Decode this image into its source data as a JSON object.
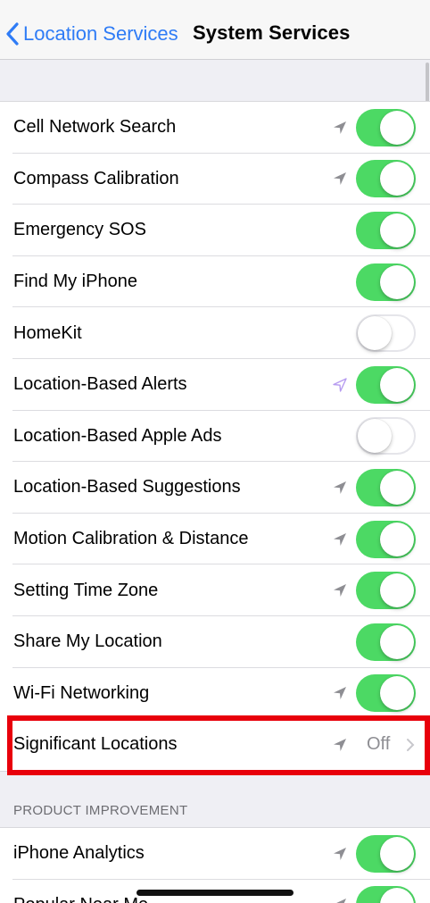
{
  "navbar": {
    "back_label": "Location Services",
    "title": "System Services"
  },
  "colors": {
    "accent": "#2f7cf6",
    "toggle_on": "#4cd964",
    "arrow_gray": "#8e8e93",
    "arrow_purple": "#b69bf0",
    "highlight": "#e8000b"
  },
  "services": [
    {
      "label": "Cell Network Search",
      "arrow": "gray",
      "toggle": "on"
    },
    {
      "label": "Compass Calibration",
      "arrow": "gray",
      "toggle": "on"
    },
    {
      "label": "Emergency SOS",
      "arrow": "none",
      "toggle": "on"
    },
    {
      "label": "Find My iPhone",
      "arrow": "none",
      "toggle": "on"
    },
    {
      "label": "HomeKit",
      "arrow": "none",
      "toggle": "off"
    },
    {
      "label": "Location-Based Alerts",
      "arrow": "purple-outline",
      "toggle": "on"
    },
    {
      "label": "Location-Based Apple Ads",
      "arrow": "none",
      "toggle": "off"
    },
    {
      "label": "Location-Based Suggestions",
      "arrow": "gray",
      "toggle": "on"
    },
    {
      "label": "Motion Calibration & Distance",
      "arrow": "gray",
      "toggle": "on"
    },
    {
      "label": "Setting Time Zone",
      "arrow": "gray",
      "toggle": "on"
    },
    {
      "label": "Share My Location",
      "arrow": "none",
      "toggle": "on"
    },
    {
      "label": "Wi-Fi Networking",
      "arrow": "gray",
      "toggle": "on"
    },
    {
      "label": "Significant Locations",
      "arrow": "gray",
      "value": "Off",
      "chevron": true
    }
  ],
  "product_improvement": {
    "header": "PRODUCT IMPROVEMENT",
    "items": [
      {
        "label": "iPhone Analytics",
        "arrow": "gray",
        "toggle": "on"
      },
      {
        "label": "Popular Near Me",
        "arrow": "gray",
        "toggle": "on"
      }
    ]
  }
}
